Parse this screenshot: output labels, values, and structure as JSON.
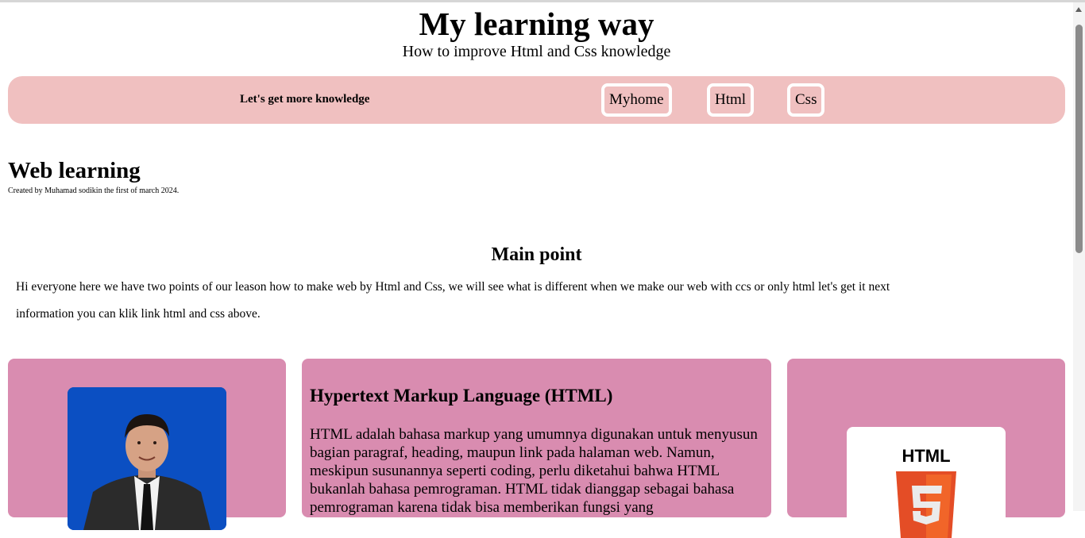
{
  "header": {
    "title": "My learning way",
    "subtitle": "How to improve Html and Css knowledge"
  },
  "nav": {
    "tagline": "Let's get more knowledge",
    "links": [
      "Myhome",
      "Html",
      "Css"
    ]
  },
  "section": {
    "title": "Web learning",
    "credit": "Created by Muhamad sodikin the first of march 2024."
  },
  "main": {
    "heading": "Main point",
    "text": "Hi everyone here we have two points of our leason how to make web by Html and Css, we will see what is different when we make our web with ccs or only html let's get it next information you can klik link html and css above."
  },
  "cards": {
    "html_title": "Hypertext Markup Language (HTML)",
    "html_text": "HTML adalah bahasa markup yang umumnya digunakan untuk menyusun bagian paragraf, heading, maupun link pada halaman web. Namun, meskipun susunannya seperti coding, perlu diketahui bahwa HTML bukanlah bahasa pemrograman. HTML tidak dianggap sebagai bahasa pemrograman karena tidak bisa memberikan fungsi yang",
    "logo_label": "HTML"
  },
  "colors": {
    "nav_bg": "#f0c0c0",
    "card_bg": "#d98cb0",
    "photo_bg": "#0b4fc2"
  }
}
